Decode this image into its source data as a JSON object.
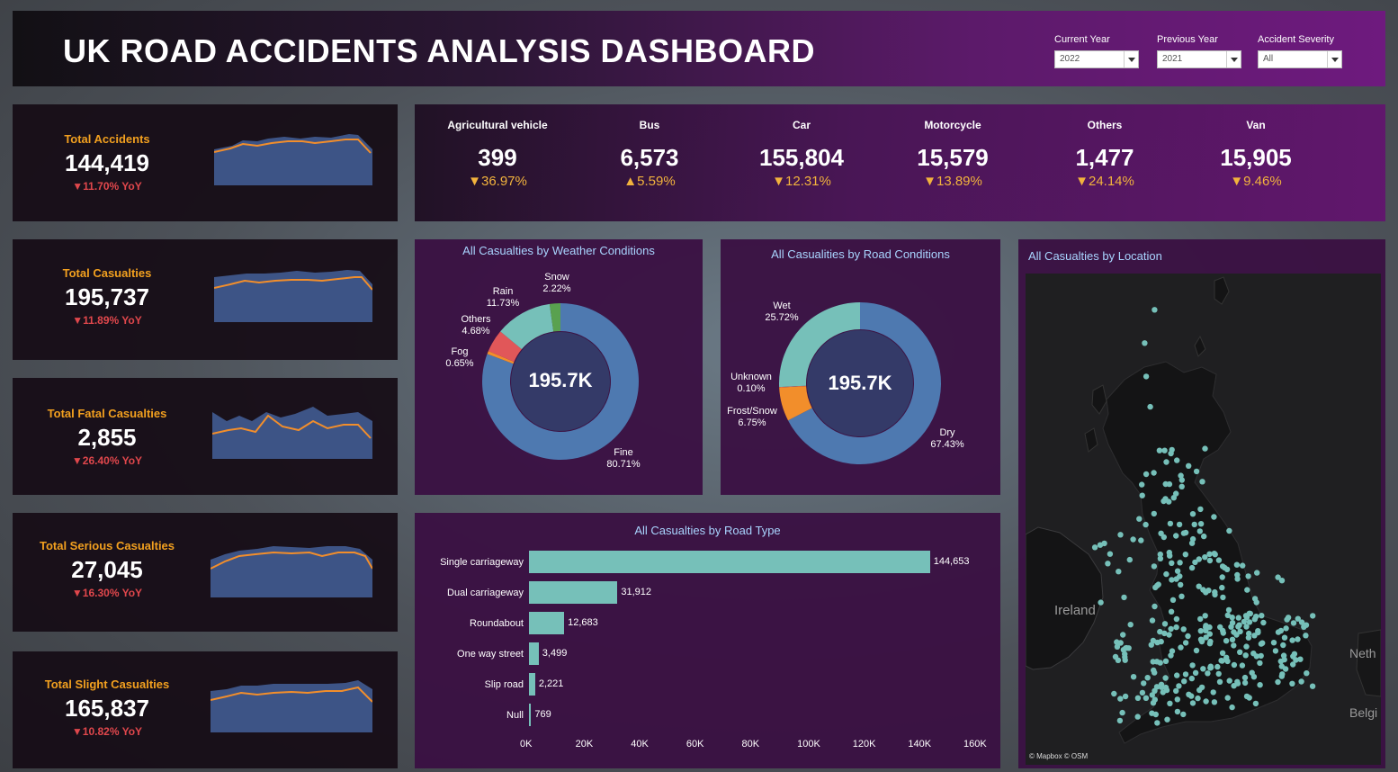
{
  "header": {
    "title": "UK ROAD ACCIDENTS ANALYSIS DASHBOARD",
    "filters": [
      {
        "label": "Current Year",
        "value": "2022"
      },
      {
        "label": "Previous Year",
        "value": "2021"
      },
      {
        "label": "Accident Severity",
        "value": "All"
      }
    ]
  },
  "kpis": [
    {
      "label": "Total Accidents",
      "value": "144,419",
      "yoy": "▼11.70% YoY"
    },
    {
      "label": "Total Casualties",
      "value": "195,737",
      "yoy": "▼11.89% YoY"
    },
    {
      "label": "Total Fatal Casualties",
      "value": "2,855",
      "yoy": "▼26.40% YoY"
    },
    {
      "label": "Total Serious Casualties",
      "value": "27,045",
      "yoy": "▼16.30% YoY"
    },
    {
      "label": "Total Slight Casualties",
      "value": "165,837",
      "yoy": "▼10.82% YoY"
    }
  ],
  "vehicles": [
    {
      "name": "Agricultural vehicle",
      "value": "399",
      "change": "▼36.97%"
    },
    {
      "name": "Bus",
      "value": "6,573",
      "change": "▲5.59%"
    },
    {
      "name": "Car",
      "value": "155,804",
      "change": "▼12.31%"
    },
    {
      "name": "Motorcycle",
      "value": "15,579",
      "change": "▼13.89%"
    },
    {
      "name": "Others",
      "value": "1,477",
      "change": "▼24.14%"
    },
    {
      "name": "Van",
      "value": "15,905",
      "change": "▼9.46%"
    }
  ],
  "colors": {
    "accent": "#f2a01f",
    "down": "#e0474c",
    "teal": "#76c0b9",
    "blue": "#4e79b0",
    "orange": "#f28e2b",
    "green": "#59a14f",
    "red": "#e15759",
    "chart_title": "#a9d5ff"
  },
  "chart_data": [
    {
      "type": "pie",
      "title": "All Casualties by Weather Conditions",
      "center_label": "195.7K",
      "slices": [
        {
          "label": "Fine",
          "value": 80.71,
          "display": "80.71%"
        },
        {
          "label": "Fog",
          "value": 0.65,
          "display": "0.65%"
        },
        {
          "label": "Others",
          "value": 4.68,
          "display": "4.68%"
        },
        {
          "label": "Rain",
          "value": 11.73,
          "display": "11.73%"
        },
        {
          "label": "Snow",
          "value": 2.22,
          "display": "2.22%"
        }
      ]
    },
    {
      "type": "pie",
      "title": "All Casualities by Road Conditions",
      "center_label": "195.7K",
      "slices": [
        {
          "label": "Dry",
          "value": 67.43,
          "display": "67.43%"
        },
        {
          "label": "Frost/Snow",
          "value": 6.75,
          "display": "6.75%"
        },
        {
          "label": "Unknown",
          "value": 0.1,
          "display": "0.10%"
        },
        {
          "label": "Wet",
          "value": 25.72,
          "display": "25.72%"
        }
      ]
    },
    {
      "type": "bar",
      "title": "All Casualties by Road Type",
      "categories": [
        "Single carriageway",
        "Dual carriageway",
        "Roundabout",
        "One way street",
        "Slip road",
        "Null"
      ],
      "values": [
        144653,
        31912,
        12683,
        3499,
        2221,
        769
      ],
      "value_labels": [
        "144,653",
        "31,912",
        "12,683",
        "3,499",
        "2,221",
        "769"
      ],
      "ticks": [
        "0K",
        "20K",
        "40K",
        "60K",
        "80K",
        "100K",
        "120K",
        "140K",
        "160K"
      ],
      "xlim": [
        0,
        160000
      ]
    }
  ],
  "map": {
    "title": "All Casualties by Location",
    "labels": [
      "Ireland",
      "Neth",
      "Belgi"
    ],
    "credit": "© Mapbox © OSM"
  }
}
